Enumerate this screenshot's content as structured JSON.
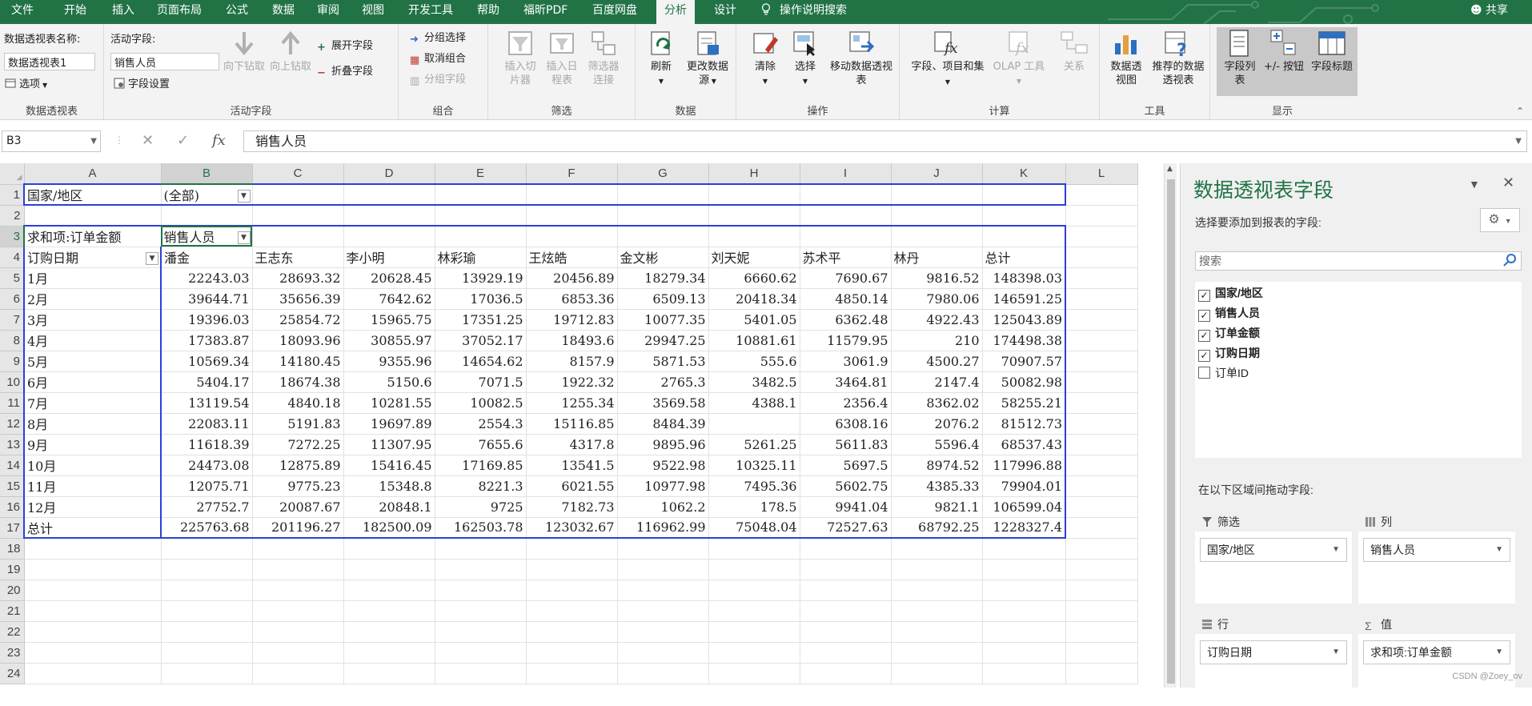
{
  "menu": {
    "tabs": [
      "文件",
      "开始",
      "插入",
      "页面布局",
      "公式",
      "数据",
      "审阅",
      "视图",
      "开发工具",
      "帮助",
      "福昕PDF",
      "百度网盘",
      "分析",
      "设计"
    ],
    "active_tab": "分析",
    "tell_me": "操作说明搜索",
    "share": "共享"
  },
  "ribbon": {
    "pivot_name_label": "数据透视表名称:",
    "pivot_name_value": "数据透视表1",
    "options_label": "选项",
    "group_pivot": "数据透视表",
    "active_field_label": "活动字段:",
    "active_field_value": "销售人员",
    "field_settings": "字段设置",
    "drill_down": "向下钻取",
    "drill_up": "向上钻取",
    "expand_field": "展开字段",
    "collapse_field": "折叠字段",
    "group_active_field": "活动字段",
    "group_selection": "分组选择",
    "ungroup": "取消组合",
    "group_field": "分组字段",
    "group_group": "组合",
    "insert_slicer": "插入切片器",
    "insert_timeline": "插入日程表",
    "filter_connections": "筛选器连接",
    "group_filter": "筛选",
    "refresh": "刷新",
    "change_source": "更改数据源",
    "group_data": "数据",
    "clear": "清除",
    "select": "选择",
    "move_pivot": "移动数据透视表",
    "group_actions": "操作",
    "fields_items_sets": "字段、项目和集",
    "olap_tools": "OLAP 工具",
    "relationships": "关系",
    "group_calc": "计算",
    "pivot_chart": "数据透视图",
    "recommended": "推荐的数据透视表",
    "group_tools": "工具",
    "field_list": "字段列表",
    "plus_minus": "+/- 按钮",
    "field_headers": "字段标题",
    "group_show": "显示"
  },
  "formula_bar": {
    "name_box": "B3",
    "content": "销售人员"
  },
  "sheet": {
    "col_headers": [
      "A",
      "B",
      "C",
      "D",
      "E",
      "F",
      "G",
      "H",
      "I",
      "J",
      "K",
      "L"
    ],
    "row_numbers": [
      "1",
      "2",
      "3",
      "4",
      "5",
      "6",
      "7",
      "8",
      "9",
      "10",
      "11",
      "12",
      "13",
      "14",
      "15",
      "16",
      "17",
      "18",
      "19",
      "20",
      "21",
      "22",
      "23",
      "24"
    ],
    "r1_label": "国家/地区",
    "r1_value": "(全部)",
    "r3_label": "求和项:订单金额",
    "r3_value": "销售人员",
    "r4_rowfield": "订购日期",
    "salespeople": [
      "潘金",
      "王志东",
      "李小明",
      "林彩瑜",
      "王炫皓",
      "金文彬",
      "刘天妮",
      "苏术平",
      "林丹",
      "总计"
    ],
    "rows": [
      {
        "label": "1月",
        "values": [
          "22243.03",
          "28693.32",
          "20628.45",
          "13929.19",
          "20456.89",
          "18279.34",
          "6660.62",
          "7690.67",
          "9816.52",
          "148398.03"
        ]
      },
      {
        "label": "2月",
        "values": [
          "39644.71",
          "35656.39",
          "7642.62",
          "17036.5",
          "6853.36",
          "6509.13",
          "20418.34",
          "4850.14",
          "7980.06",
          "146591.25"
        ]
      },
      {
        "label": "3月",
        "values": [
          "19396.03",
          "25854.72",
          "15965.75",
          "17351.25",
          "19712.83",
          "10077.35",
          "5401.05",
          "6362.48",
          "4922.43",
          "125043.89"
        ]
      },
      {
        "label": "4月",
        "values": [
          "17383.87",
          "18093.96",
          "30855.97",
          "37052.17",
          "18493.6",
          "29947.25",
          "10881.61",
          "11579.95",
          "210",
          "174498.38"
        ]
      },
      {
        "label": "5月",
        "values": [
          "10569.34",
          "14180.45",
          "9355.96",
          "14654.62",
          "8157.9",
          "5871.53",
          "555.6",
          "3061.9",
          "4500.27",
          "70907.57"
        ]
      },
      {
        "label": "6月",
        "values": [
          "5404.17",
          "18674.38",
          "5150.6",
          "7071.5",
          "1922.32",
          "2765.3",
          "3482.5",
          "3464.81",
          "2147.4",
          "50082.98"
        ]
      },
      {
        "label": "7月",
        "values": [
          "13119.54",
          "4840.18",
          "10281.55",
          "10082.5",
          "1255.34",
          "3569.58",
          "4388.1",
          "2356.4",
          "8362.02",
          "58255.21"
        ]
      },
      {
        "label": "8月",
        "values": [
          "22083.11",
          "5191.83",
          "19697.89",
          "2554.3",
          "15116.85",
          "8484.39",
          "",
          "6308.16",
          "2076.2",
          "81512.73"
        ]
      },
      {
        "label": "9月",
        "values": [
          "11618.39",
          "7272.25",
          "11307.95",
          "7655.6",
          "4317.8",
          "9895.96",
          "5261.25",
          "5611.83",
          "5596.4",
          "68537.43"
        ]
      },
      {
        "label": "10月",
        "values": [
          "24473.08",
          "12875.89",
          "15416.45",
          "17169.85",
          "13541.5",
          "9522.98",
          "10325.11",
          "5697.5",
          "8974.52",
          "117996.88"
        ]
      },
      {
        "label": "11月",
        "values": [
          "12075.71",
          "9775.23",
          "15348.8",
          "8221.3",
          "6021.55",
          "10977.98",
          "7495.36",
          "5602.75",
          "4385.33",
          "79904.01"
        ]
      },
      {
        "label": "12月",
        "values": [
          "27752.7",
          "20087.67",
          "20848.1",
          "9725",
          "7182.73",
          "1062.2",
          "178.5",
          "9941.04",
          "9821.1",
          "106599.04"
        ]
      }
    ],
    "total_label": "总计",
    "total_values": [
      "225763.68",
      "201196.27",
      "182500.09",
      "162503.78",
      "123032.67",
      "116962.99",
      "75048.04",
      "72527.63",
      "68792.25",
      "1228327.4"
    ]
  },
  "pane": {
    "title": "数据透视表字段",
    "subtitle": "选择要添加到报表的字段:",
    "search_placeholder": "搜索",
    "fields": [
      {
        "name": "国家/地区",
        "checked": true
      },
      {
        "name": "销售人员",
        "checked": true
      },
      {
        "name": "订单金额",
        "checked": true
      },
      {
        "name": "订购日期",
        "checked": true
      },
      {
        "name": "订单ID",
        "checked": false
      }
    ],
    "drag_hint": "在以下区域间拖动字段:",
    "filter_label": "筛选",
    "filter_item": "国家/地区",
    "columns_label": "列",
    "columns_item": "销售人员",
    "rows_label": "行",
    "rows_item": "订购日期",
    "values_label": "值",
    "values_item": "求和项:订单金额"
  },
  "watermark": "CSDN @Zoey_ov",
  "colors": {
    "excel_green": "#217346",
    "pivot_border": "#2e3fd6"
  }
}
